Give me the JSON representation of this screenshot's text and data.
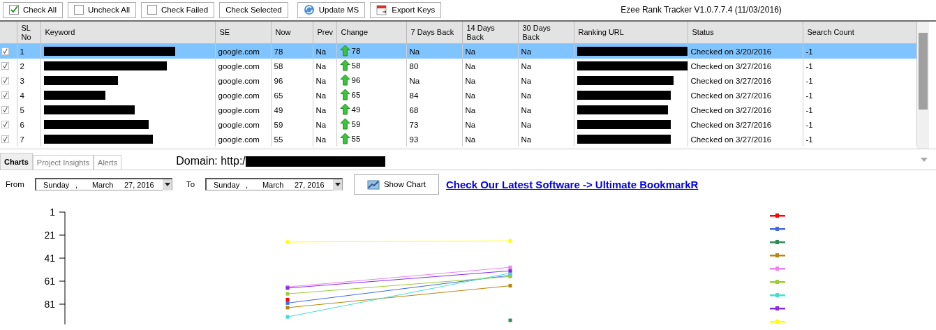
{
  "toolbar": {
    "buttons": [
      {
        "label": "Check All",
        "kind": "checkbox",
        "checked": true
      },
      {
        "label": "Uncheck All",
        "kind": "checkbox",
        "checked": false
      },
      {
        "label": "Check Failed",
        "kind": "checkbox",
        "checked": false
      },
      {
        "label": "Check Selected",
        "kind": "plain"
      },
      {
        "label": "Update MS",
        "kind": "update"
      },
      {
        "label": "Export Keys",
        "kind": "export"
      }
    ],
    "app_title": "Ezee Rank Tracker V1.0.7.7.4 (11/03/2016)"
  },
  "table": {
    "columns": [
      "SL No",
      "Keyword",
      "SE",
      "Now",
      "Prev",
      "Change",
      "7 Days Back",
      "14 Days Back",
      "30 Days Back",
      "Ranking URL",
      "Status",
      "Search Count"
    ],
    "rows": [
      {
        "checked": true,
        "selected": true,
        "sl": "1",
        "se": "google.com",
        "now": "78",
        "prev": "Na",
        "change": "78",
        "d7": "Na",
        "d14": "Na",
        "d30": "Na",
        "status": "Checked on 3/20/2016",
        "search_count": "-1"
      },
      {
        "checked": true,
        "selected": false,
        "sl": "2",
        "se": "google.com",
        "now": "58",
        "prev": "Na",
        "change": "58",
        "d7": "80",
        "d14": "Na",
        "d30": "Na",
        "status": "Checked on 3/27/2016",
        "search_count": "-1"
      },
      {
        "checked": true,
        "selected": false,
        "sl": "3",
        "se": "google.com",
        "now": "96",
        "prev": "Na",
        "change": "96",
        "d7": "Na",
        "d14": "Na",
        "d30": "Na",
        "status": "Checked on 3/27/2016",
        "search_count": "-1"
      },
      {
        "checked": true,
        "selected": false,
        "sl": "4",
        "se": "google.com",
        "now": "65",
        "prev": "Na",
        "change": "65",
        "d7": "84",
        "d14": "Na",
        "d30": "Na",
        "status": "Checked on 3/27/2016",
        "search_count": "-1"
      },
      {
        "checked": true,
        "selected": false,
        "sl": "5",
        "se": "google.com",
        "now": "49",
        "prev": "Na",
        "change": "49",
        "d7": "68",
        "d14": "Na",
        "d30": "Na",
        "status": "Checked on 3/27/2016",
        "search_count": "-1"
      },
      {
        "checked": true,
        "selected": false,
        "sl": "6",
        "se": "google.com",
        "now": "59",
        "prev": "Na",
        "change": "59",
        "d7": "73",
        "d14": "Na",
        "d30": "Na",
        "status": "Checked on 3/27/2016",
        "search_count": "-1"
      },
      {
        "checked": true,
        "selected": false,
        "sl": "7",
        "se": "google.com",
        "now": "55",
        "prev": "Na",
        "change": "55",
        "d7": "93",
        "d14": "Na",
        "d30": "Na",
        "status": "Checked on 3/27/2016",
        "search_count": "-1"
      }
    ]
  },
  "bottom_tabs": [
    {
      "label": "Charts",
      "selected": true
    },
    {
      "label": "Project Insights",
      "selected": false
    },
    {
      "label": "Alerts",
      "selected": false
    }
  ],
  "domain": "Domain: http:/",
  "date_range": {
    "from_label": "From",
    "from": [
      "Sunday",
      ",",
      "March",
      "27, 2016"
    ],
    "to_label": "To",
    "to": [
      "Sunday",
      ",",
      "March",
      "27, 2016"
    ],
    "show_button": "Show Chart",
    "promo_link": "Check Our Latest Software -> Ultimate BookmarkR"
  },
  "rank_chart": {
    "y_labels": [
      "1",
      "21",
      "41",
      "61",
      "81"
    ]
  }
}
